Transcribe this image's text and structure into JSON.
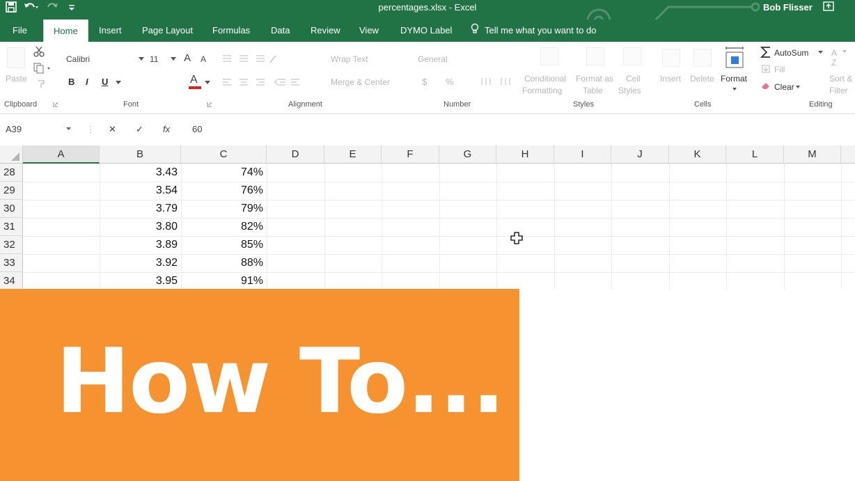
{
  "window": {
    "title": "percentages.xlsx - Excel",
    "user": "Bob Flisser",
    "qat": [
      "save-icon",
      "undo-icon",
      "redo-icon",
      "customize-icon"
    ]
  },
  "tabs": [
    {
      "label": "File"
    },
    {
      "label": "Home",
      "active": true
    },
    {
      "label": "Insert"
    },
    {
      "label": "Page Layout"
    },
    {
      "label": "Formulas"
    },
    {
      "label": "Data"
    },
    {
      "label": "Review"
    },
    {
      "label": "View"
    },
    {
      "label": "DYMO Label"
    }
  ],
  "tell_me": "Tell me what you want to do",
  "ribbon": {
    "clipboard": {
      "paste": "Paste",
      "group": "Clipboard"
    },
    "font": {
      "name": "Calibri",
      "size": "11",
      "bold": "B",
      "italic": "I",
      "underline": "U",
      "grow": "A",
      "shrink": "A",
      "color": "A",
      "group": "Font"
    },
    "alignment": {
      "wrap": "Wrap Text",
      "merge": "Merge & Center",
      "group": "Alignment"
    },
    "number": {
      "format": "General",
      "currency": "$",
      "percent": "%",
      "group": "Number"
    },
    "styles": {
      "conditional_1": "Conditional",
      "conditional_2": "Formatting",
      "format_as_1": "Format as",
      "format_as_2": "Table",
      "cell_1": "Cell",
      "cell_2": "Styles",
      "group": "Styles"
    },
    "cells": {
      "insert": "Insert",
      "delete": "Delete",
      "format": "Format",
      "group": "Cells"
    },
    "editing": {
      "autosum": "AutoSum",
      "fill": "Fill",
      "clear": "Clear",
      "sort_1": "Sort &",
      "sort_2": "Filter",
      "group": "Editing"
    }
  },
  "formula_bar": {
    "name_box": "A39",
    "cancel": "✕",
    "enter": "✓",
    "fx": "fx",
    "value": "60"
  },
  "columns": [
    "A",
    "B",
    "C",
    "D",
    "E",
    "F",
    "G",
    "H",
    "I",
    "J",
    "K",
    "L",
    "M"
  ],
  "rows": [
    {
      "num": "28",
      "b": "3.43",
      "c": "74%"
    },
    {
      "num": "29",
      "b": "3.54",
      "c": "76%"
    },
    {
      "num": "30",
      "b": "3.79",
      "c": "79%"
    },
    {
      "num": "31",
      "b": "3.80",
      "c": "82%"
    },
    {
      "num": "32",
      "b": "3.89",
      "c": "85%"
    },
    {
      "num": "33",
      "b": "3.92",
      "c": "88%"
    },
    {
      "num": "34",
      "b": "3.95",
      "c": "91%"
    }
  ],
  "overlay": {
    "text": "How To...",
    "color": "#f79230"
  },
  "colors": {
    "accent": "#217346",
    "font_color_bar": "#e02020"
  }
}
